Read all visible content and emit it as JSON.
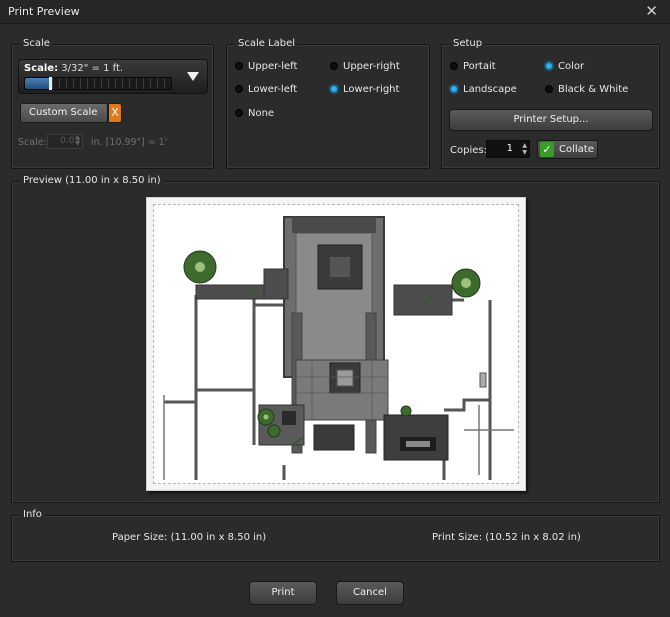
{
  "window": {
    "title": "Print Preview",
    "close_glyph": "✕"
  },
  "scale": {
    "legend": "Scale",
    "dropdown_prefix": "Scale:",
    "dropdown_value": "3/32\" = 1 ft.",
    "slider_fraction": 0.18,
    "custom_scale_label": "Custom Scale",
    "custom_scale_remove": "X",
    "scale_field_label": "Scale:",
    "scale_field_value": "0.03",
    "scale_field_suffix": "in. [10.99\"] = 1'"
  },
  "scale_label": {
    "legend": "Scale Label",
    "options": [
      "Upper-left",
      "Upper-right",
      "Lower-left",
      "Lower-right",
      "None"
    ],
    "selected": "Lower-right"
  },
  "setup": {
    "legend": "Setup",
    "orientation_options": [
      "Portait",
      "Landscape"
    ],
    "orientation_selected": "Landscape",
    "color_options": [
      "Color",
      "Black & White"
    ],
    "color_selected": "Color",
    "printer_setup_label": "Printer Setup...",
    "copies_label": "Copies:",
    "copies_value": "1",
    "collate_label": "Collate",
    "collate_checked": true
  },
  "preview": {
    "legend": "Preview (11.00 in x 8.50 in)"
  },
  "info": {
    "legend": "Info",
    "paper_size": "Paper Size: (11.00 in x 8.50 in)",
    "print_size": "Print Size: (10.52 in x 8.02 in)"
  },
  "footer": {
    "print_label": "Print",
    "cancel_label": "Cancel"
  },
  "colors": {
    "accent_radio": "#2fb0ea",
    "remove_orange": "#e07a1a",
    "collate_green": "#3a9c28",
    "background": "#2b2b2b"
  }
}
